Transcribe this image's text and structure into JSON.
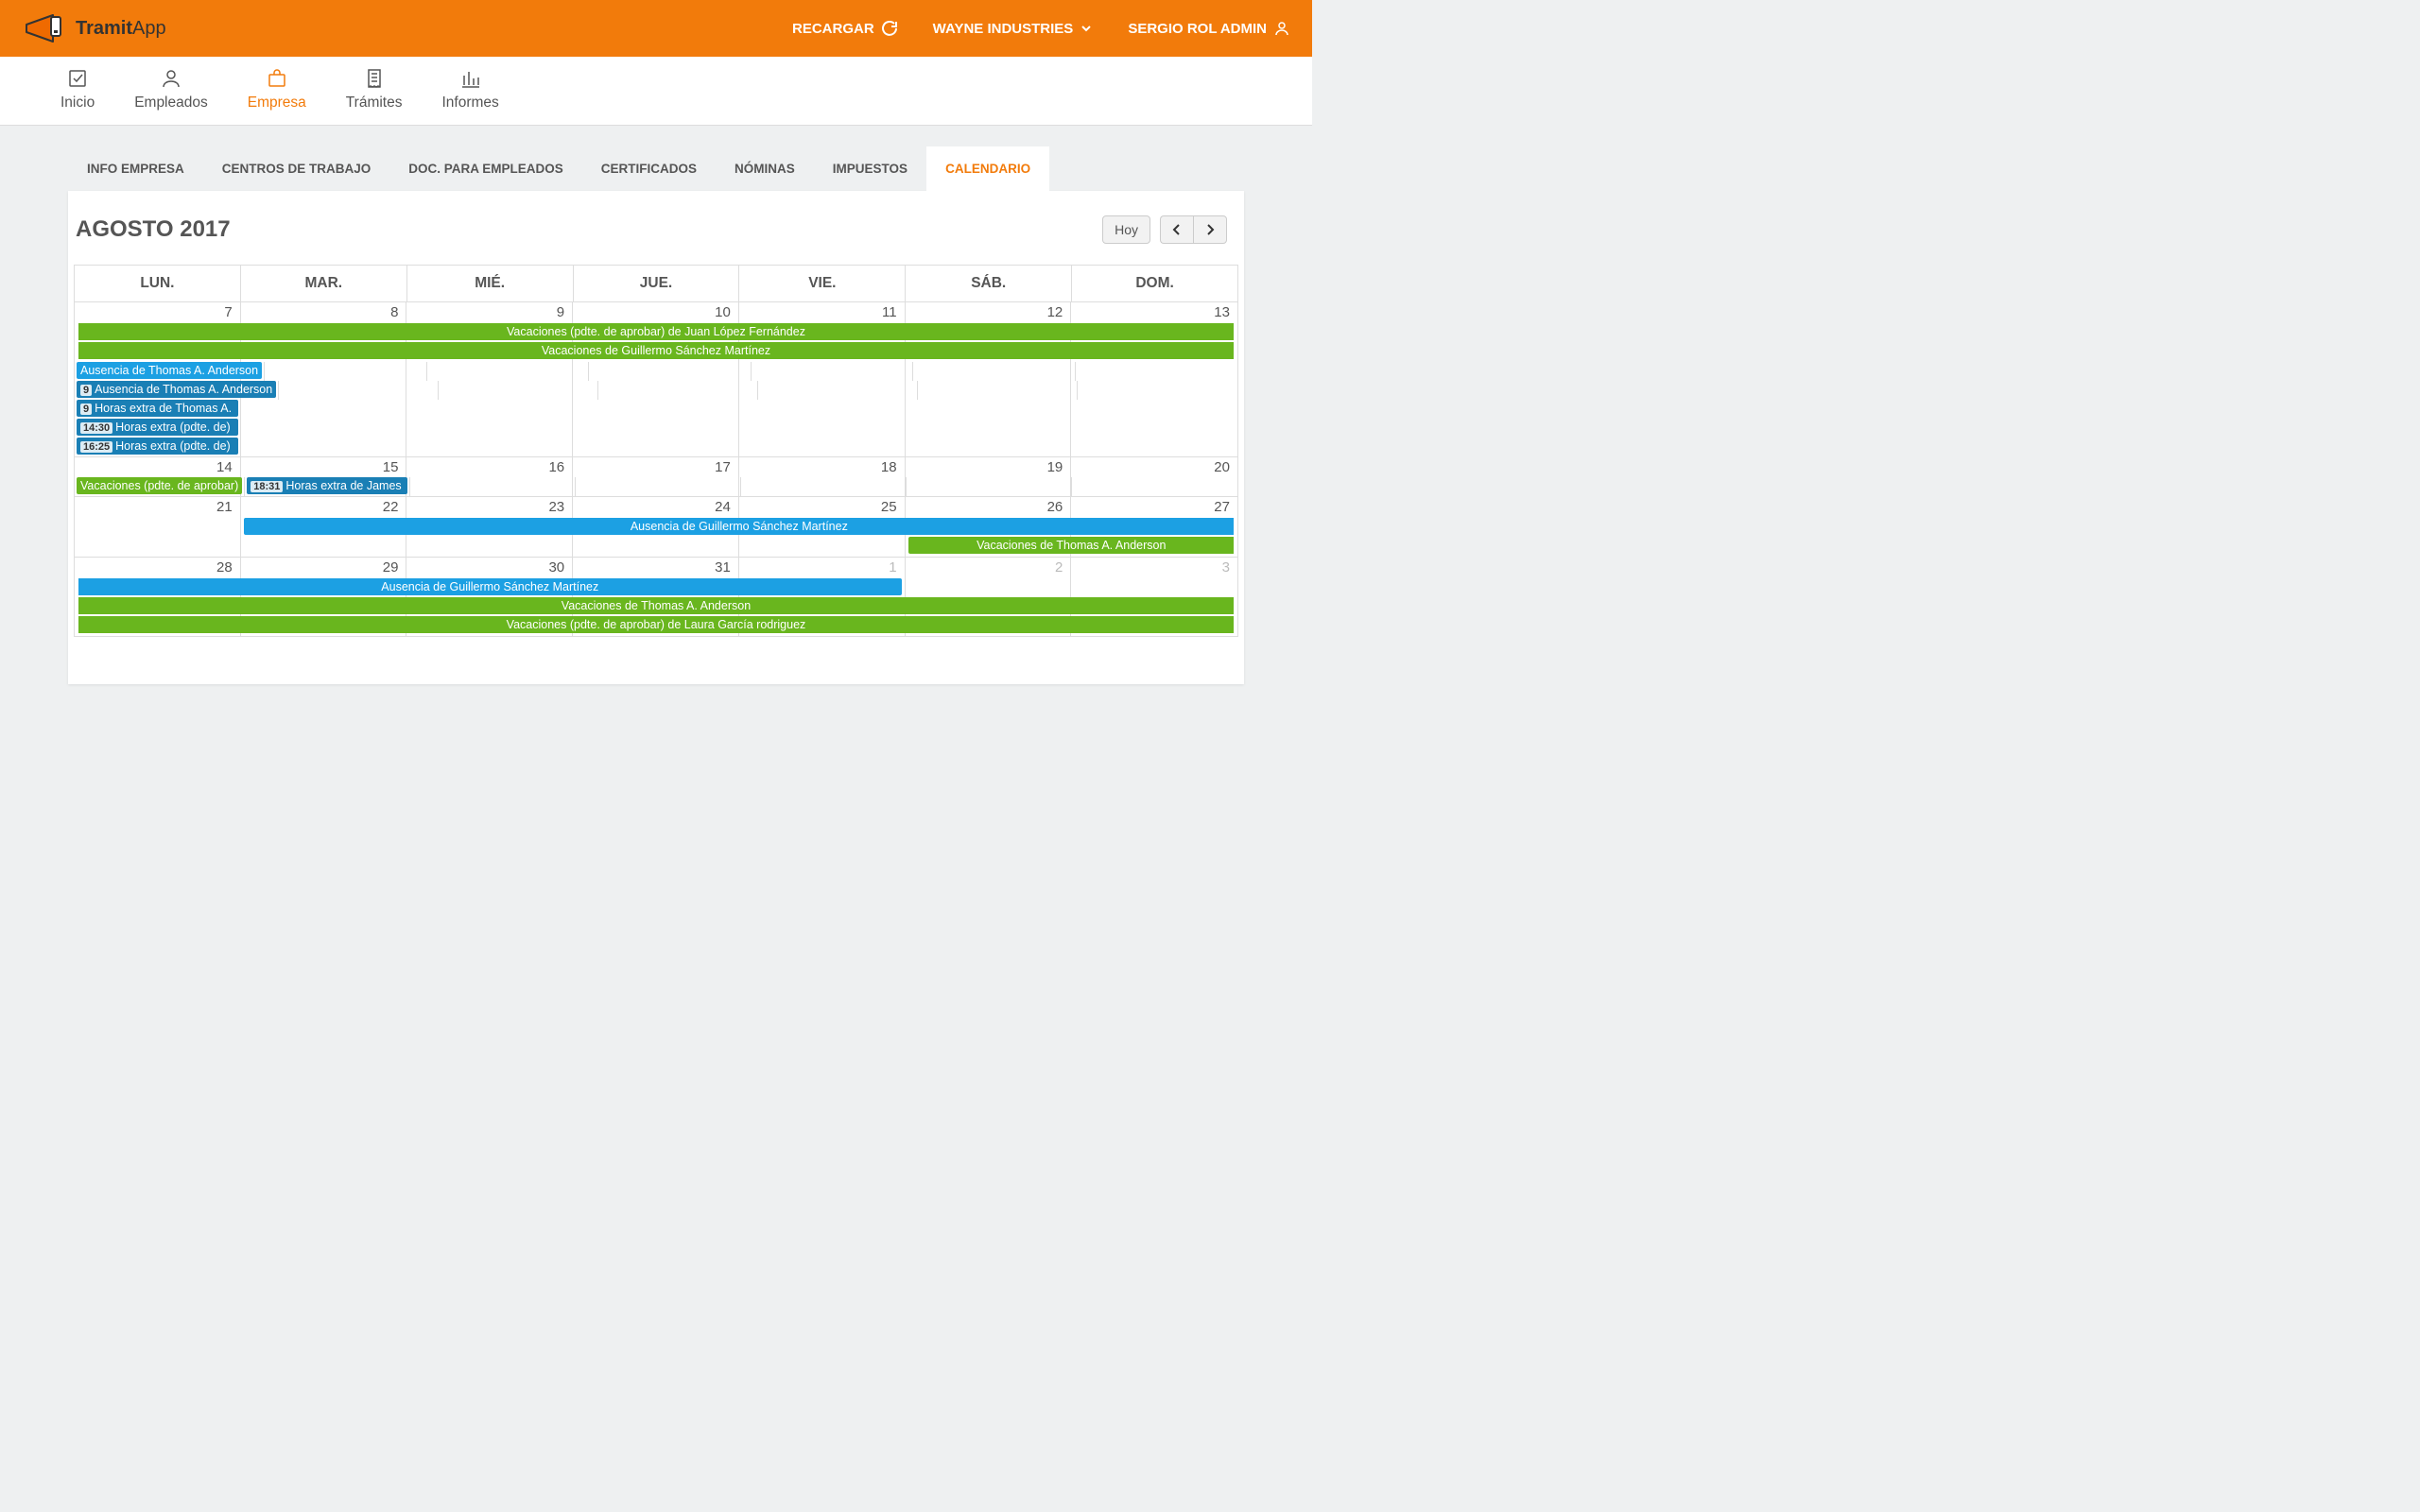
{
  "brand": {
    "name1": "Tramit",
    "name2": "App"
  },
  "topbar": {
    "reload": "RECARGAR",
    "company": "WAYNE INDUSTRIES",
    "user": "SERGIO ROL ADMIN"
  },
  "nav": {
    "items": [
      {
        "label": "Inicio"
      },
      {
        "label": "Empleados"
      },
      {
        "label": "Empresa",
        "active": true
      },
      {
        "label": "Trámites"
      },
      {
        "label": "Informes"
      }
    ]
  },
  "tabs": [
    {
      "label": "INFO EMPRESA"
    },
    {
      "label": "CENTROS DE TRABAJO"
    },
    {
      "label": "DOC. PARA EMPLEADOS"
    },
    {
      "label": "CERTIFICADOS"
    },
    {
      "label": "NÓMINAS"
    },
    {
      "label": "IMPUESTOS"
    },
    {
      "label": "CALENDARIO",
      "active": true
    }
  ],
  "calendar": {
    "title": "AGOSTO 2017",
    "today_label": "Hoy",
    "day_headers": [
      "LUN.",
      "MAR.",
      "MIÉ.",
      "JUE.",
      "VIE.",
      "SÁB.",
      "DOM."
    ],
    "weeks": [
      {
        "days": [
          7,
          8,
          9,
          10,
          11,
          12,
          13
        ],
        "bands": [
          {
            "text": "Vacaciones (pdte. de aprobar) de Juan López Fernández",
            "color": "green",
            "start": 0,
            "span": 7,
            "open_start": true,
            "open_end": true
          },
          {
            "text": "Vacaciones de Guillermo Sánchez Martínez",
            "color": "green",
            "start": 0,
            "span": 7,
            "open_start": true,
            "open_end": true
          }
        ],
        "cell_events": {
          "0": [
            {
              "text": "Ausencia de Thomas A. Anderson",
              "color": "blue"
            },
            {
              "time": "9",
              "text": "Ausencia de Thomas A. Anderson",
              "color": "blue-d"
            },
            {
              "time": "9",
              "text": "Horas extra de Thomas A.",
              "color": "blue-d"
            },
            {
              "time": "14:30",
              "text": "Horas extra (pdte. de)",
              "color": "blue-d"
            },
            {
              "time": "16:25",
              "text": "Horas extra (pdte. de)",
              "color": "blue-d"
            }
          ]
        }
      },
      {
        "days": [
          14,
          15,
          16,
          17,
          18,
          19,
          20
        ],
        "bands": [],
        "cell_events": {
          "0": [
            {
              "text": "Vacaciones (pdte. de aprobar)",
              "color": "green"
            }
          ],
          "1": [
            {
              "time": "18:31",
              "text": "Horas extra de James",
              "color": "blue-d"
            }
          ]
        }
      },
      {
        "days": [
          21,
          22,
          23,
          24,
          25,
          26,
          27
        ],
        "bands": [
          {
            "text": "Ausencia de Guillermo Sánchez Martínez",
            "color": "blue",
            "start": 1,
            "span": 6,
            "open_end": true
          },
          {
            "text": "Vacaciones de Thomas A. Anderson",
            "color": "green",
            "start": 5,
            "span": 2,
            "open_end": true
          }
        ],
        "cell_events": {}
      },
      {
        "days": [
          28,
          29,
          30,
          31
        ],
        "trailing": [
          1,
          2,
          3
        ],
        "bands": [
          {
            "text": "Ausencia de Guillermo Sánchez Martínez",
            "color": "blue",
            "start": 0,
            "span": 5,
            "open_start": true
          },
          {
            "text": "Vacaciones de Thomas A. Anderson",
            "color": "green",
            "start": 0,
            "span": 7,
            "open_start": true,
            "open_end": true
          },
          {
            "text": "Vacaciones (pdte. de aprobar) de Laura García rodriguez",
            "color": "green",
            "start": 0,
            "span": 7,
            "open_start": true,
            "open_end": true
          }
        ],
        "cell_events": {}
      }
    ]
  }
}
